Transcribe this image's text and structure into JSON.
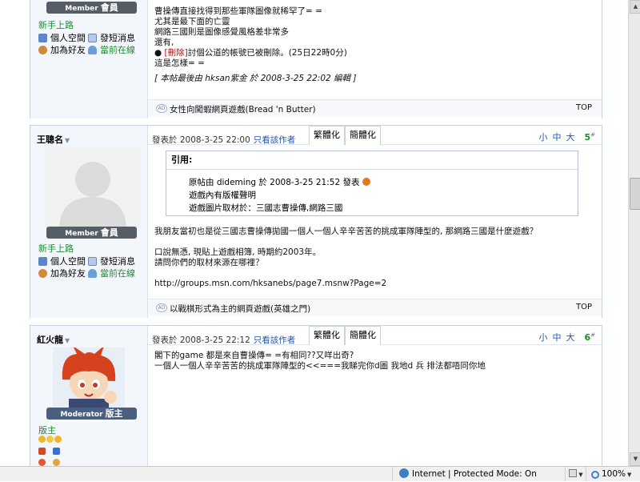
{
  "posts": [
    {
      "rank_title": "Member",
      "rank_zh": "會員",
      "level": "新手上路",
      "links": {
        "space": "個人空間",
        "pm": "發短消息",
        "addfriend": "加為好友",
        "online": "當前在線"
      },
      "lines": [
        "曹操傳直接找得到那些軍隊圖像就稀罕了= =",
        "尤其是最下面的亡靈",
        "網路三國則是圖像感覺風格差非常多",
        "還有,",
        "討個公道的帳號已被刪除。(25日22時0分)",
        "這是怎樣= ="
      ],
      "deleted_tag": "[刪除]",
      "edit_note": "[ 本帖最後由 hksan紫金 於 2008-3-25 22:02 編輯 ]",
      "ad": "女性向闖蝦網頁遊戲(Bread 'n Butter)",
      "top": "TOP"
    },
    {
      "username": "王聰名",
      "rank_title": "Member",
      "rank_zh": "會員",
      "level": "新手上路",
      "links": {
        "space": "個人空間",
        "pm": "發短消息",
        "addfriend": "加為好友",
        "online": "當前在線"
      },
      "time": "發表於 2008-3-25 22:00",
      "author_only": "只看該作者",
      "tab_trad": "繁體化",
      "tab_simp": "簡體化",
      "sizes": [
        "小",
        "中",
        "大"
      ],
      "floor": "5",
      "quote_title": "引用:",
      "quote_lines": [
        "原帖由 dideming 於 2008-3-25 21:52 發表",
        "遊戲內有版權聲明",
        "遊戲圖片取材於：三國志曹操傳,網路三國"
      ],
      "quote_author": "dideming",
      "body": [
        "我朋友當初也是從三國志曹操傳拋國一個人一個人辛辛苦苦的挑成軍隊陣型的, 那網路三國是什麼遊戲？",
        "",
        "口說無憑, 現貼上遊戲相簿, 時期約2003年。",
        "請問你們的取材來源在哪裡？",
        "",
        "http://groups.msn.com/hksanebs/page7.msnw?Page=2"
      ],
      "ad": "以戰棋形式為主的網頁遊戲(英雄之門)",
      "top": "TOP"
    },
    {
      "username": "紅火龍",
      "rank_title": "Moderator",
      "rank_zh": "版主",
      "level": "版主",
      "time": "發表於 2008-3-25 22:12",
      "author_only": "只看該作者",
      "tab_trad": "繁體化",
      "tab_simp": "簡體化",
      "sizes": [
        "小",
        "中",
        "大"
      ],
      "floor": "6",
      "body": [
        "閣下的game 都是來自曹操傳= =有相同??又咩出奇?",
        "一個人一個人辛辛苦苦的挑成軍隊陣型的<<===我睇完你d圖 我地d 兵 排法都唔同你地"
      ]
    }
  ],
  "floor_mark": "#",
  "status": {
    "zone": "Internet | Protected Mode: On",
    "zoom": "100%"
  }
}
